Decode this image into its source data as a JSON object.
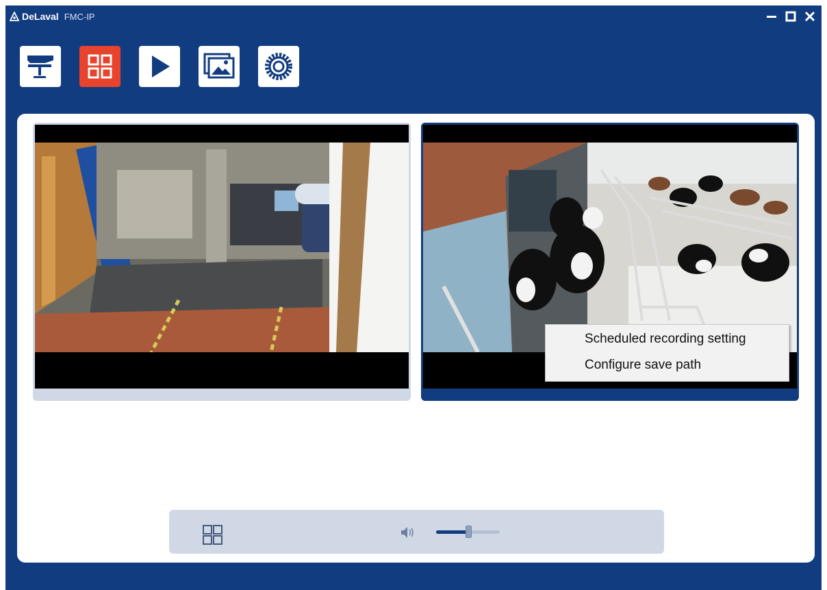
{
  "window": {
    "brand": "DeLaval",
    "product": "FMC-IP",
    "controls": [
      "minimize",
      "maximize",
      "close"
    ]
  },
  "toolbar": {
    "buttons": [
      {
        "icon": "milking-station-icon",
        "active": false
      },
      {
        "icon": "grid-view-icon",
        "active": true
      },
      {
        "icon": "play-icon",
        "active": false
      },
      {
        "icon": "gallery-icon",
        "active": false
      },
      {
        "icon": "settings-gear-icon",
        "active": false
      }
    ]
  },
  "cameras": [
    {
      "scene": "milking robot stall",
      "selected": false
    },
    {
      "scene": "barn with cows",
      "selected": true
    }
  ],
  "context_menu": {
    "items": [
      "Scheduled recording setting",
      "Configure save path"
    ]
  },
  "bottom_bar": {
    "layout_icon": "grid-layout-icon",
    "volume_icon": "speaker-icon",
    "volume_level": 0.5
  },
  "colors": {
    "primary": "#123c80",
    "accent": "#e8432c",
    "panel": "#ffffff",
    "tile_border": "#d0d8e6"
  }
}
